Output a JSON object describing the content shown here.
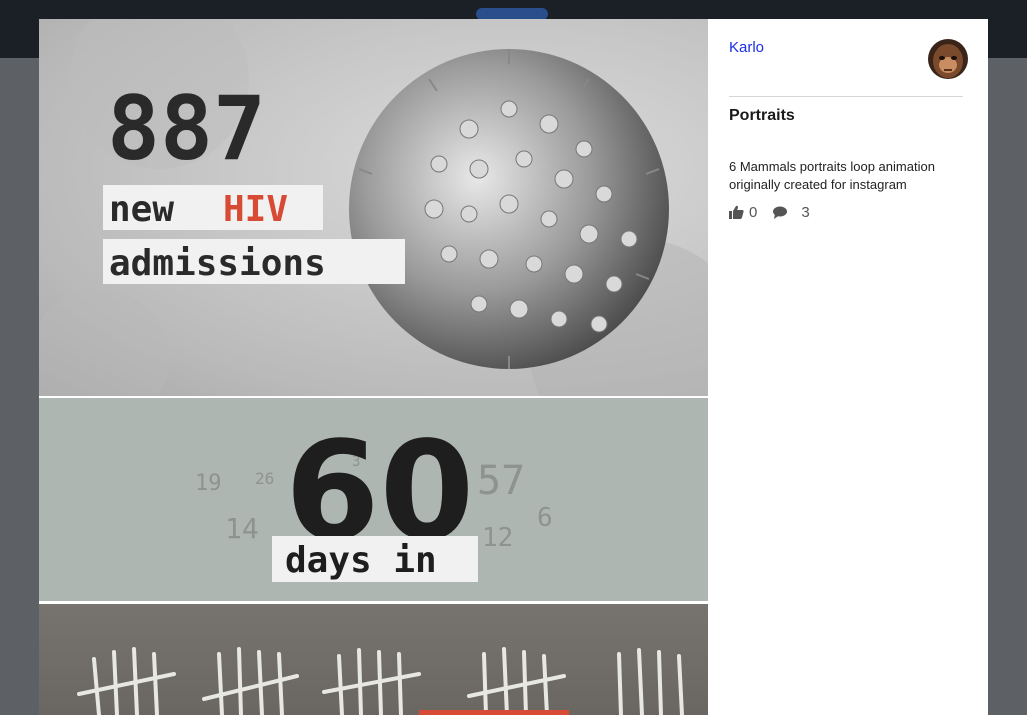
{
  "project": {
    "author": "Karlo",
    "title": "Portraits",
    "description": "6 Mammals portraits loop animation originally created for instagram",
    "likes": "0",
    "comments": "3"
  },
  "icons": {
    "likes": "thumbs-up-icon",
    "comments": "comment-icon"
  },
  "media": {
    "image1": {
      "number": "887",
      "line_prefix": "new",
      "highlight": "HIV",
      "line2": "admissions"
    },
    "image2": {
      "number": "60",
      "subtitle": "days in",
      "tally_numbers": [
        "19",
        "26",
        "3",
        "57",
        "14",
        "12",
        "6"
      ]
    }
  },
  "colors": {
    "author_link": "#1a2ee6",
    "highlight_text": "#d74a33",
    "topbar": "#1b1f26",
    "accent_pill": "#2a4d8c"
  }
}
